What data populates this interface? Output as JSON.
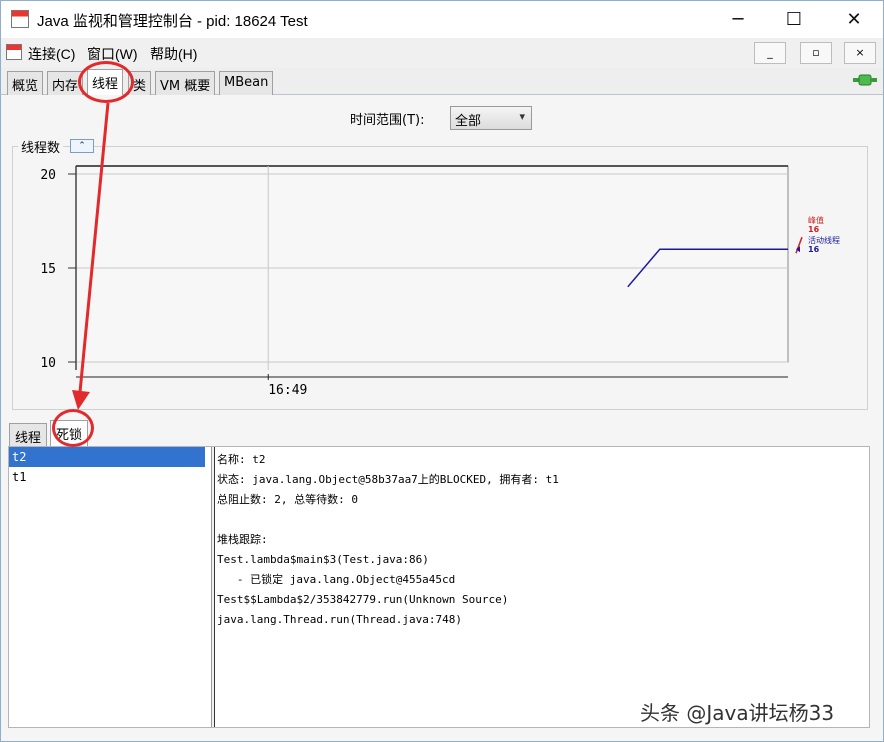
{
  "window": {
    "title": "Java 监视和管理控制台 - pid: 18624 Test",
    "minimize_glyph": "─",
    "maximize_glyph": "☐",
    "close_glyph": "✕"
  },
  "menubar": {
    "items": [
      "连接(C)",
      "窗口(W)",
      "帮助(H)"
    ],
    "mdi_buttons": [
      "_",
      "▫",
      "×"
    ]
  },
  "tabs": [
    {
      "label": "概览"
    },
    {
      "label": "内存"
    },
    {
      "label": "线程",
      "active": true
    },
    {
      "label": "类"
    },
    {
      "label": "VM 概要"
    },
    {
      "label": "MBean"
    }
  ],
  "time_range": {
    "label": "时间范围(T):",
    "value": "全部",
    "arrow": "▾"
  },
  "chart_panel": {
    "title": "线程数",
    "collapse_glyph": "⌃"
  },
  "chart_data": {
    "type": "line",
    "title": "线程数",
    "ylim": [
      10,
      20
    ],
    "y_ticks": [
      "20",
      "15",
      "10"
    ],
    "x_ticks": [
      "16:49"
    ],
    "series": [
      {
        "name": "活动线程",
        "color": "#1a1aa0",
        "points": [
          [
            0.775,
            14
          ],
          [
            0.82,
            16
          ],
          [
            1.0,
            16
          ]
        ]
      }
    ],
    "legend": {
      "peak_label": "峰值",
      "peak_value": "16",
      "live_label": "活动线程",
      "live_value": "16",
      "peak_color": "#d32020",
      "live_color": "#1a1aa0",
      "position": "right"
    }
  },
  "bottom_tabs": [
    {
      "label": "线程"
    },
    {
      "label": "死锁",
      "active": true
    }
  ],
  "threads": [
    {
      "name": "t2",
      "selected": true
    },
    {
      "name": "t1"
    }
  ],
  "detail": {
    "name_line": "名称: t2",
    "state_line": "状态: java.lang.Object@58b37aa7上的BLOCKED, 拥有者: t1",
    "blocked_line": "总阻止数: 2, 总等待数: 0",
    "blank": "",
    "stack_header": "堆栈跟踪:",
    "frame1": "Test.lambda$main$3(Test.java:86)",
    "lock_line": "   - 已锁定 java.lang.Object@455a45cd",
    "frame2": "Test$$Lambda$2/353842779.run(Unknown Source)",
    "frame3": "java.lang.Thread.run(Thread.java:748)"
  },
  "watermark": "头条 @Java讲坛杨33",
  "colors": {
    "annotation": "#e2292c",
    "selection": "#3373d0"
  }
}
